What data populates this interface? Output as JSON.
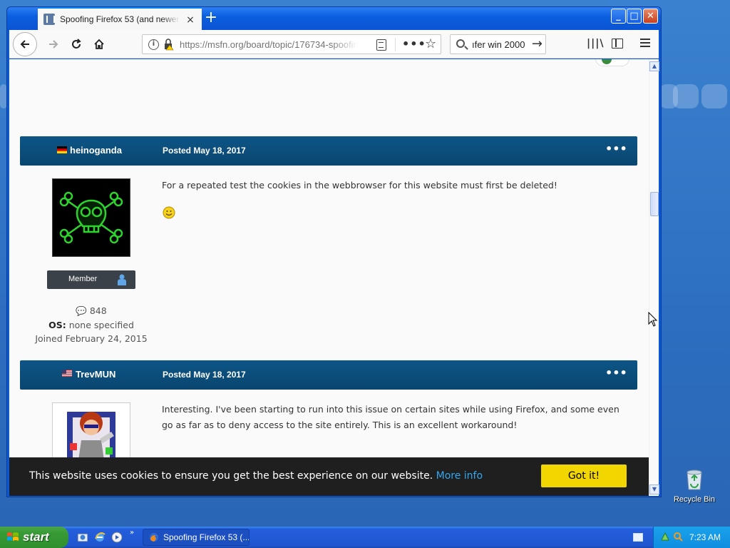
{
  "browser": {
    "tab_title": "Spoofing Firefox 53 (and newer versions",
    "tab_close": "×",
    "new_tab": "+",
    "url": "https://msfn.org/board/topic/176734-spoofing",
    "search_value": "ıfer win 2000",
    "window_buttons": {
      "minimize": "_",
      "maximize": "□",
      "close": "✕"
    }
  },
  "posts": [
    {
      "author": "heinoganda",
      "posted": "Posted May 18, 2017",
      "menu": "•••",
      "text": "For a repeated test the cookies in the webbrowser for this website must first be deleted!",
      "badge": "Member",
      "post_count": "848",
      "os_label": "OS:",
      "os_value": "none specified",
      "joined": "Joined February 24, 2015"
    },
    {
      "author": "TrevMUN",
      "posted": "Posted May 18, 2017",
      "menu": "•••",
      "text": "Interesting. I've been starting to run into this issue on certain sites while using Firefox, and some even go as far as to deny access to the site entirely. This is an excellent workaround!"
    }
  ],
  "cookie_banner": {
    "message": "This website uses cookies to ensure you get the best experience on our website.",
    "more_info": "More info",
    "button": "Got it!"
  },
  "desktop": {
    "recycle_bin": "Recycle Bin"
  },
  "taskbar": {
    "start": "start",
    "task_title": "Spoofing Firefox 53 (...",
    "quick_launch_chevron": "»",
    "clock": "7:23 AM"
  },
  "colors": {
    "post_header": "#0b4a75",
    "cookie_bg": "#1f1f1f",
    "cookie_button": "#f1d600",
    "link": "#31a8f0"
  }
}
